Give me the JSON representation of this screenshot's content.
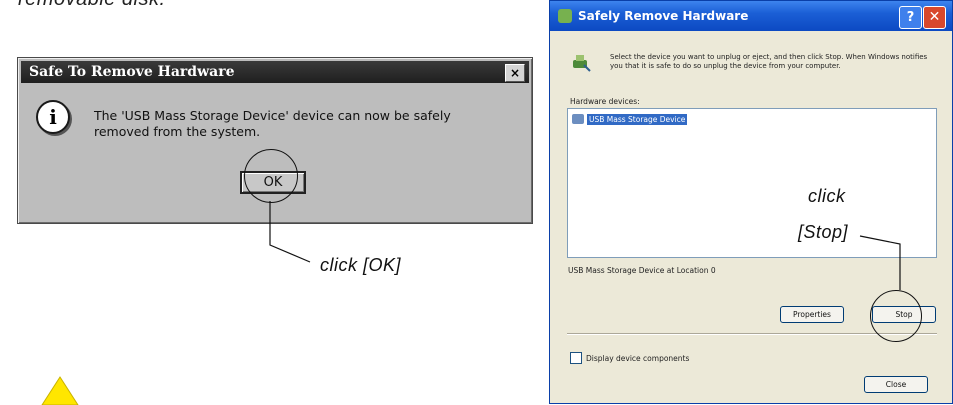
{
  "top_fragment": "removable disk.",
  "left_dialog": {
    "title": "Safe To Remove Hardware",
    "close_glyph": "×",
    "info_glyph": "i",
    "message": "The 'USB Mass Storage Device' device can now be safely removed from the system.",
    "ok_label": "OK"
  },
  "callout_ok": "click [OK]",
  "callout_stop_line1": "click",
  "callout_stop_line2": "[Stop]",
  "right_dialog": {
    "title": "Safely Remove Hardware",
    "help_glyph": "?",
    "close_glyph": "✕",
    "intro": "Select the device you want to unplug or eject, and then click Stop. When Windows notifies you that it is safe to do so unplug the device from your computer.",
    "hardware_label": "Hardware devices:",
    "devices": [
      "USB Mass Storage Device"
    ],
    "status": "USB Mass Storage Device at Location 0",
    "properties_label": "Properties",
    "stop_label": "Stop",
    "display_components_label": "Display device components",
    "close_label": "Close"
  },
  "colors": {
    "xp_title_blue": "#1b5fd6",
    "xp_close_red": "#d8482c",
    "selection_blue": "#316ac5",
    "warning_yellow": "#ffe600"
  }
}
